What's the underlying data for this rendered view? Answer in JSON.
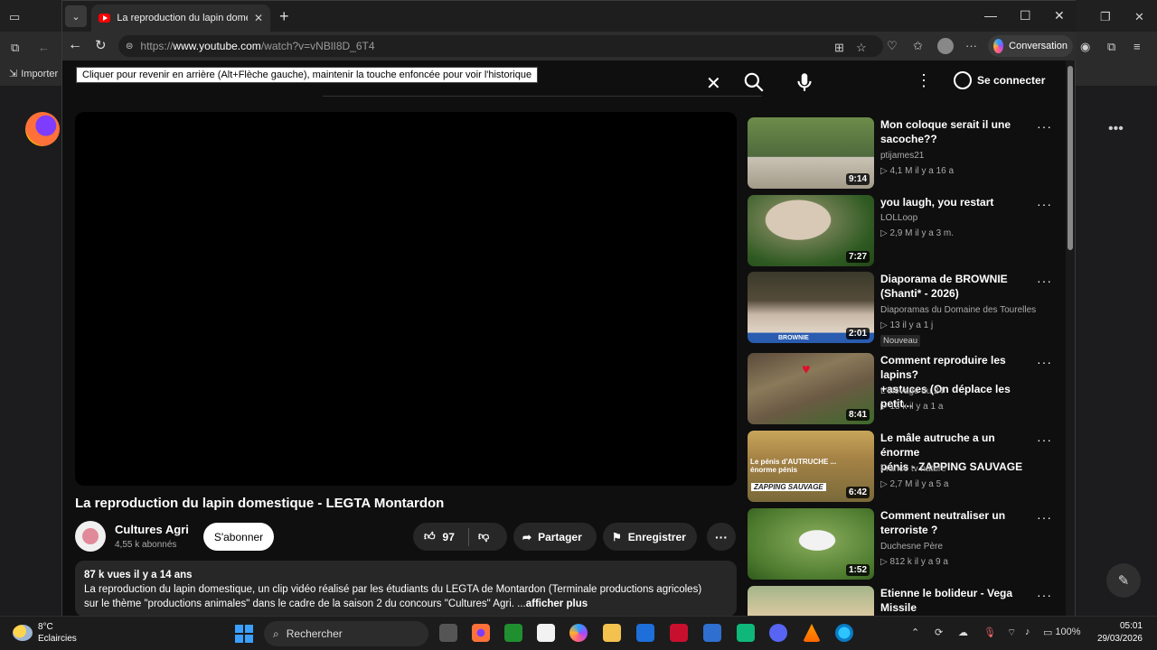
{
  "browser": {
    "tab_title": "La reproduction du lapin domestique - LEGTA Montardon - YouTube",
    "url_prefix": "https://",
    "url_host": "www.youtube.com",
    "url_path": "/watch?v=vNBlI8D_6T4",
    "copilot_label": "Conversation",
    "tooltip": "Cliquer pour revenir en arrière (Alt+Flèche gauche), maintenir la touche enfoncée pour voir l'historique"
  },
  "background_window": {
    "import_label": "Importer"
  },
  "youtube": {
    "signin_label": "Se connecter",
    "video": {
      "title": "La reproduction du lapin domestique - LEGTA Montardon",
      "channel": "Cultures Agri",
      "subscribers": "4,55 k abonnés",
      "subscribe_label": "S'abonner",
      "likes": "97",
      "share_label": "Partager",
      "save_label": "Enregistrer",
      "meta": "87 k vues  il y a 14 ans",
      "description_line1": "La reproduction du lapin domestique, un clip vidéo réalisé par les étudiants du LEGTA de Montardon (Terminale productions agricoles)",
      "description_line2": "sur le thème \"productions animales\" dans le cadre de la saison 2 du concours \"Cultures\" Agri. ...",
      "show_more": "afficher plus"
    },
    "recommendations": [
      {
        "title_l1": "Mon coloque serait il une",
        "title_l2": "sacoche??",
        "channel": "ptijames21",
        "stats": "▷ 4,1 M  il y a 16 a",
        "duration": "9:14",
        "badge": ""
      },
      {
        "title_l1": "you laugh, you restart",
        "title_l2": "",
        "channel": "LOLLoop",
        "stats": "▷ 2,9 M  il y a 3 m.",
        "duration": "7:27",
        "badge": ""
      },
      {
        "title_l1": "Diaporama de BROWNIE",
        "title_l2": "(Shanti* - 2026)",
        "channel": "Diaporamas du Domaine des Tourelles",
        "stats": "▷ 13  il y a 1 j",
        "duration": "2:01",
        "badge": "Nouveau"
      },
      {
        "title_l1": "Comment reproduire les lapins?",
        "title_l2": "+astuces (On déplace les petit...",
        "channel": "L'élevage du 24",
        "stats": "▷ 13 k  il y a 1 a",
        "duration": "8:41",
        "badge": ""
      },
      {
        "title_l1": "Le mâle autruche a un énorme",
        "title_l2": "pénis - ZAPPING SAUVAGE",
        "channel": "France tv nature",
        "stats": "▷ 2,7 M  il y a 5 a",
        "duration": "6:42",
        "badge": ""
      },
      {
        "title_l1": "Comment neutraliser un",
        "title_l2": "terroriste ?",
        "channel": "Duchesne Père",
        "stats": "▷ 812 k  il y a 9 a",
        "duration": "1:52",
        "badge": ""
      },
      {
        "title_l1": "Etienne le bolideur - Vega",
        "title_l2": "Missile",
        "channel": "",
        "stats": "",
        "duration": "",
        "badge": ""
      }
    ],
    "thumb5_caption_l1": "Le pénis d'AUTRUCHE ...",
    "thumb5_caption_l2": "énorme pénis",
    "thumb5_caption_l3": "ZAPPING SAUVAGE",
    "thumb3_caption": "BROWNIE"
  },
  "taskbar": {
    "temp": "8°C",
    "weather": "Eclaircies",
    "search_label": "Rechercher",
    "battery": "100%",
    "time": "05:01",
    "date": "29/03/2026"
  }
}
